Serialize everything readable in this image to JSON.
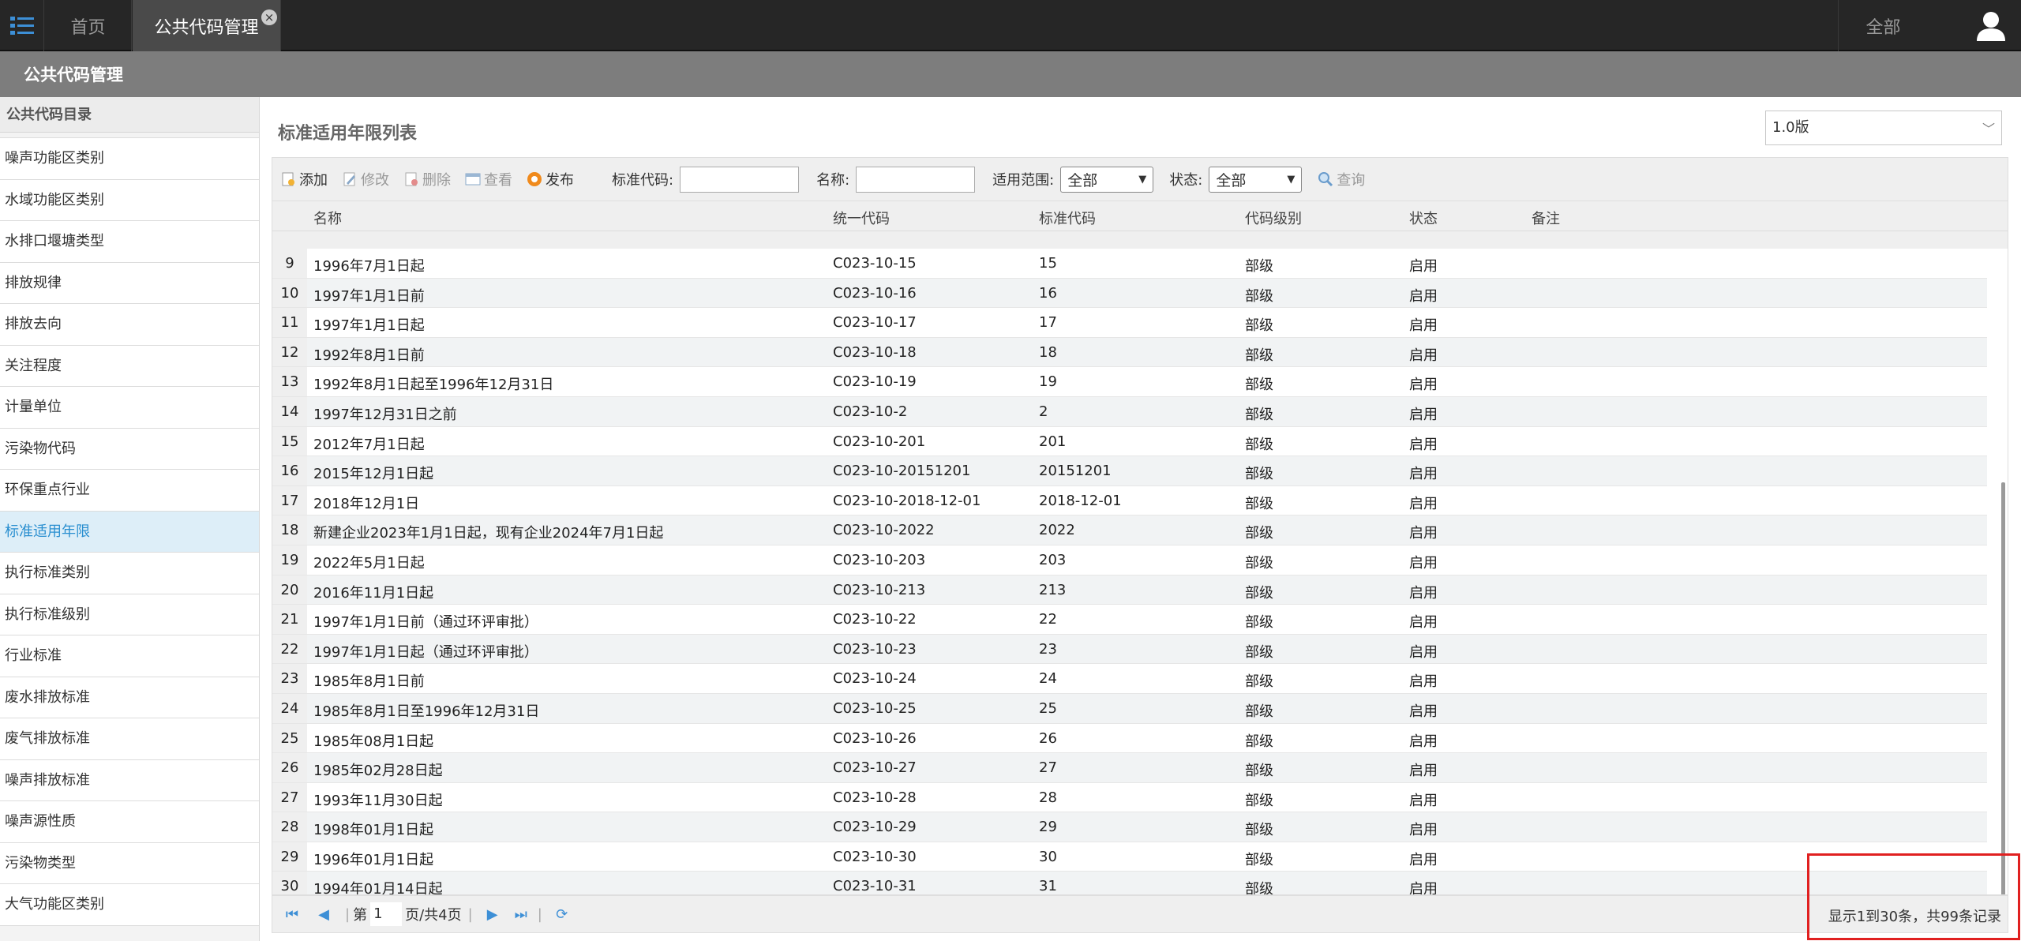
{
  "topbar": {
    "tabs": [
      {
        "label": "首页"
      },
      {
        "label": "公共代码管理"
      }
    ],
    "scope_label": "全部"
  },
  "titlebar": {
    "title": "公共代码管理"
  },
  "sidebar": {
    "heading": "公共代码目录",
    "items": [
      {
        "label": "噪声功能区类别"
      },
      {
        "label": "水域功能区类别"
      },
      {
        "label": "水排口堰塘类型"
      },
      {
        "label": "排放规律"
      },
      {
        "label": "排放去向"
      },
      {
        "label": "关注程度"
      },
      {
        "label": "计量单位"
      },
      {
        "label": "污染物代码"
      },
      {
        "label": "环保重点行业"
      },
      {
        "label": "标准适用年限",
        "active": true
      },
      {
        "label": "执行标准类别"
      },
      {
        "label": "执行标准级别"
      },
      {
        "label": "行业标准"
      },
      {
        "label": "废水排放标准"
      },
      {
        "label": "废气排放标准"
      },
      {
        "label": "噪声排放标准"
      },
      {
        "label": "噪声源性质"
      },
      {
        "label": "污染物类型"
      },
      {
        "label": "大气功能区类别"
      }
    ]
  },
  "main": {
    "title": "标准适用年限列表",
    "version": "1.0版",
    "toolbar": {
      "add": "添加",
      "edit": "修改",
      "delete": "删除",
      "view": "查看",
      "publish": "发布",
      "code_label": "标准代码:",
      "name_label": "名称:",
      "scope_label": "适用范围:",
      "scope_value": "全部",
      "status_label": "状态:",
      "status_value": "全部",
      "query": "查询"
    },
    "columns": [
      "名称",
      "统一代码",
      "标准代码",
      "代码级别",
      "状态",
      "备注"
    ],
    "rows": [
      {
        "n": "9",
        "name": "1996年7月1日起",
        "code": "C023-10-15",
        "std": "15",
        "level": "部级",
        "status": "启用"
      },
      {
        "n": "10",
        "name": "1997年1月1日前",
        "code": "C023-10-16",
        "std": "16",
        "level": "部级",
        "status": "启用"
      },
      {
        "n": "11",
        "name": "1997年1月1日起",
        "code": "C023-10-17",
        "std": "17",
        "level": "部级",
        "status": "启用"
      },
      {
        "n": "12",
        "name": "1992年8月1日前",
        "code": "C023-10-18",
        "std": "18",
        "level": "部级",
        "status": "启用"
      },
      {
        "n": "13",
        "name": "1992年8月1日起至1996年12月31日",
        "code": "C023-10-19",
        "std": "19",
        "level": "部级",
        "status": "启用"
      },
      {
        "n": "14",
        "name": "1997年12月31日之前",
        "code": "C023-10-2",
        "std": "2",
        "level": "部级",
        "status": "启用"
      },
      {
        "n": "15",
        "name": "2012年7月1日起",
        "code": "C023-10-201",
        "std": "201",
        "level": "部级",
        "status": "启用"
      },
      {
        "n": "16",
        "name": "2015年12月1日起",
        "code": "C023-10-20151201",
        "std": "20151201",
        "level": "部级",
        "status": "启用"
      },
      {
        "n": "17",
        "name": "2018年12月1日",
        "code": "C023-10-2018-12-01",
        "std": "2018-12-01",
        "level": "部级",
        "status": "启用"
      },
      {
        "n": "18",
        "name": "新建企业2023年1月1日起，现有企业2024年7月1日起",
        "code": "C023-10-2022",
        "std": "2022",
        "level": "部级",
        "status": "启用"
      },
      {
        "n": "19",
        "name": "2022年5月1日起",
        "code": "C023-10-203",
        "std": "203",
        "level": "部级",
        "status": "启用"
      },
      {
        "n": "20",
        "name": "2016年11月1日起",
        "code": "C023-10-213",
        "std": "213",
        "level": "部级",
        "status": "启用"
      },
      {
        "n": "21",
        "name": "1997年1月1日前（通过环评审批）",
        "code": "C023-10-22",
        "std": "22",
        "level": "部级",
        "status": "启用"
      },
      {
        "n": "22",
        "name": "1997年1月1日起（通过环评审批）",
        "code": "C023-10-23",
        "std": "23",
        "level": "部级",
        "status": "启用"
      },
      {
        "n": "23",
        "name": "1985年8月1日前",
        "code": "C023-10-24",
        "std": "24",
        "level": "部级",
        "status": "启用"
      },
      {
        "n": "24",
        "name": "1985年8月1日至1996年12月31日",
        "code": "C023-10-25",
        "std": "25",
        "level": "部级",
        "status": "启用"
      },
      {
        "n": "25",
        "name": "1985年08月1日起",
        "code": "C023-10-26",
        "std": "26",
        "level": "部级",
        "status": "启用"
      },
      {
        "n": "26",
        "name": "1985年02月28日起",
        "code": "C023-10-27",
        "std": "27",
        "level": "部级",
        "status": "启用"
      },
      {
        "n": "27",
        "name": "1993年11月30日起",
        "code": "C023-10-28",
        "std": "28",
        "level": "部级",
        "status": "启用"
      },
      {
        "n": "28",
        "name": "1998年01月1日起",
        "code": "C023-10-29",
        "std": "29",
        "level": "部级",
        "status": "启用"
      },
      {
        "n": "29",
        "name": "1996年01月1日起",
        "code": "C023-10-30",
        "std": "30",
        "level": "部级",
        "status": "启用"
      },
      {
        "n": "30",
        "name": "1994年01月14日起",
        "code": "C023-10-31",
        "std": "31",
        "level": "部级",
        "status": "启用"
      }
    ],
    "pager": {
      "page_prefix": "第",
      "page_value": "1",
      "page_suffix": "页/共4页",
      "info": "显示1到30条，共99条记录"
    }
  },
  "colors": {
    "accent": "#2a8fd0",
    "highlight": "#e02020",
    "topbar": "#262626",
    "titlebar": "#7d7d7d"
  },
  "icons": [
    "menu-list-icon",
    "user-icon",
    "add-icon",
    "edit-icon",
    "delete-icon",
    "view-icon",
    "publish-icon",
    "search-icon",
    "first-page-icon",
    "prev-page-icon",
    "next-page-icon",
    "last-page-icon",
    "refresh-icon"
  ]
}
